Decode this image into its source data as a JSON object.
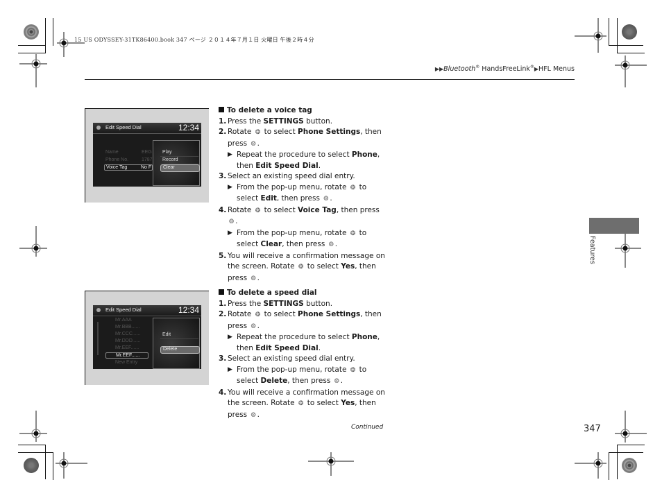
{
  "print_header": "15 US ODYSSEY-31TK86400.book  347 ページ  ２０１４年７月１日  火曜日  午後２時４分",
  "breadcrumb": {
    "items": [
      {
        "prefix": "▶▶",
        "text": "Bluetooth",
        "italic": true,
        "sup": "®"
      },
      {
        "prefix": "",
        "text": " HandsFreeLink",
        "italic": false,
        "sup": "®"
      },
      {
        "prefix": "▶",
        "text": "HFL Menus",
        "italic": false,
        "sup": ""
      }
    ]
  },
  "icons": {
    "selector_knob": "interface-dial-rotate-icon",
    "press_knob": "interface-dial-press-icon",
    "arrow": "▶"
  },
  "screens": {
    "voice_tag": {
      "title": "Edit Speed Dial",
      "clock": "12:34",
      "rows": [
        {
          "label": "Name",
          "value": "EEG"
        },
        {
          "label": "Phone No.",
          "value": "1787"
        },
        {
          "label": "Voice Tag",
          "value": "No F",
          "selected": true
        }
      ],
      "popup": [
        "Play",
        "Record",
        "Clear"
      ],
      "popup_selected": "Clear"
    },
    "speed_dial": {
      "title": "Edit Speed Dial",
      "clock": "12:34",
      "rows": [
        "Mr.AAA",
        "Mr.BBB......",
        "Mr.CCC......",
        "Mr.DDD......",
        "Mr.EEF......",
        "Mr.EEF......",
        "New Entry"
      ],
      "selected_row": "Mr.EEF......",
      "popup": [
        "Edit",
        "Delete"
      ],
      "popup_selected": "Delete"
    }
  },
  "section1": {
    "heading": "To delete a voice tag",
    "steps": [
      {
        "num": "1.",
        "parts": [
          [
            "Press the ",
            false
          ],
          [
            "SETTINGS",
            true
          ],
          [
            " button.",
            false
          ]
        ]
      },
      {
        "num": "2.",
        "parts": [
          [
            "Rotate ",
            false
          ],
          [
            "ICON_ROTATE",
            false
          ],
          [
            " to select ",
            false
          ],
          [
            "Phone Settings",
            true
          ],
          [
            ", then press ",
            false
          ],
          [
            "ICON_PRESS",
            false
          ],
          [
            ".",
            false
          ]
        ],
        "sub": [
          [
            [
              "Repeat the procedure to select ",
              false
            ],
            [
              "Phone",
              true
            ],
            [
              ", then ",
              false
            ],
            [
              "Edit Speed Dial",
              true
            ],
            [
              ".",
              false
            ]
          ]
        ]
      },
      {
        "num": "3.",
        "parts": [
          [
            "Select an existing speed dial entry.",
            false
          ]
        ],
        "sub": [
          [
            [
              "From the pop-up menu, rotate ",
              false
            ],
            [
              "ICON_ROTATE",
              false
            ],
            [
              " to select ",
              false
            ],
            [
              "Edit",
              true
            ],
            [
              ", then press ",
              false
            ],
            [
              "ICON_PRESS",
              false
            ],
            [
              ".",
              false
            ]
          ]
        ]
      },
      {
        "num": "4.",
        "parts": [
          [
            "Rotate ",
            false
          ],
          [
            "ICON_ROTATE",
            false
          ],
          [
            " to select ",
            false
          ],
          [
            "Voice Tag",
            true
          ],
          [
            ", then press ",
            false
          ],
          [
            "ICON_PRESS",
            false
          ],
          [
            ".",
            false
          ]
        ],
        "sub": [
          [
            [
              "From the pop-up menu, rotate ",
              false
            ],
            [
              "ICON_ROTATE",
              false
            ],
            [
              " to select ",
              false
            ],
            [
              "Clear",
              true
            ],
            [
              ", then press ",
              false
            ],
            [
              "ICON_PRESS",
              false
            ],
            [
              ".",
              false
            ]
          ]
        ]
      },
      {
        "num": "5.",
        "parts": [
          [
            "You will receive a confirmation message on the screen. Rotate ",
            false
          ],
          [
            "ICON_ROTATE",
            false
          ],
          [
            " to select ",
            false
          ],
          [
            "Yes",
            true
          ],
          [
            ", then press ",
            false
          ],
          [
            "ICON_PRESS",
            false
          ],
          [
            ".",
            false
          ]
        ]
      }
    ]
  },
  "section2": {
    "heading": "To delete a speed dial",
    "steps": [
      {
        "num": "1.",
        "parts": [
          [
            "Press the ",
            false
          ],
          [
            "SETTINGS",
            true
          ],
          [
            " button.",
            false
          ]
        ]
      },
      {
        "num": "2.",
        "parts": [
          [
            "Rotate ",
            false
          ],
          [
            "ICON_ROTATE",
            false
          ],
          [
            " to select ",
            false
          ],
          [
            "Phone Settings",
            true
          ],
          [
            ", then press ",
            false
          ],
          [
            "ICON_PRESS",
            false
          ],
          [
            ".",
            false
          ]
        ],
        "sub": [
          [
            [
              "Repeat the procedure to select ",
              false
            ],
            [
              "Phone",
              true
            ],
            [
              ", then ",
              false
            ],
            [
              "Edit Speed Dial",
              true
            ],
            [
              ".",
              false
            ]
          ]
        ]
      },
      {
        "num": "3.",
        "parts": [
          [
            "Select an existing speed dial entry.",
            false
          ]
        ],
        "sub": [
          [
            [
              "From the pop-up menu, rotate ",
              false
            ],
            [
              "ICON_ROTATE",
              false
            ],
            [
              " to select ",
              false
            ],
            [
              "Delete",
              true
            ],
            [
              ", then press ",
              false
            ],
            [
              "ICON_PRESS",
              false
            ],
            [
              ".",
              false
            ]
          ]
        ]
      },
      {
        "num": "4.",
        "parts": [
          [
            "You will receive a confirmation message on the screen. Rotate ",
            false
          ],
          [
            "ICON_ROTATE",
            false
          ],
          [
            " to select ",
            false
          ],
          [
            "Yes",
            true
          ],
          [
            ", then press ",
            false
          ],
          [
            "ICON_PRESS",
            false
          ],
          [
            ".",
            false
          ]
        ]
      }
    ]
  },
  "footer": {
    "continued": "Continued",
    "page_number": "347"
  },
  "side_tab": {
    "label": "Features"
  }
}
